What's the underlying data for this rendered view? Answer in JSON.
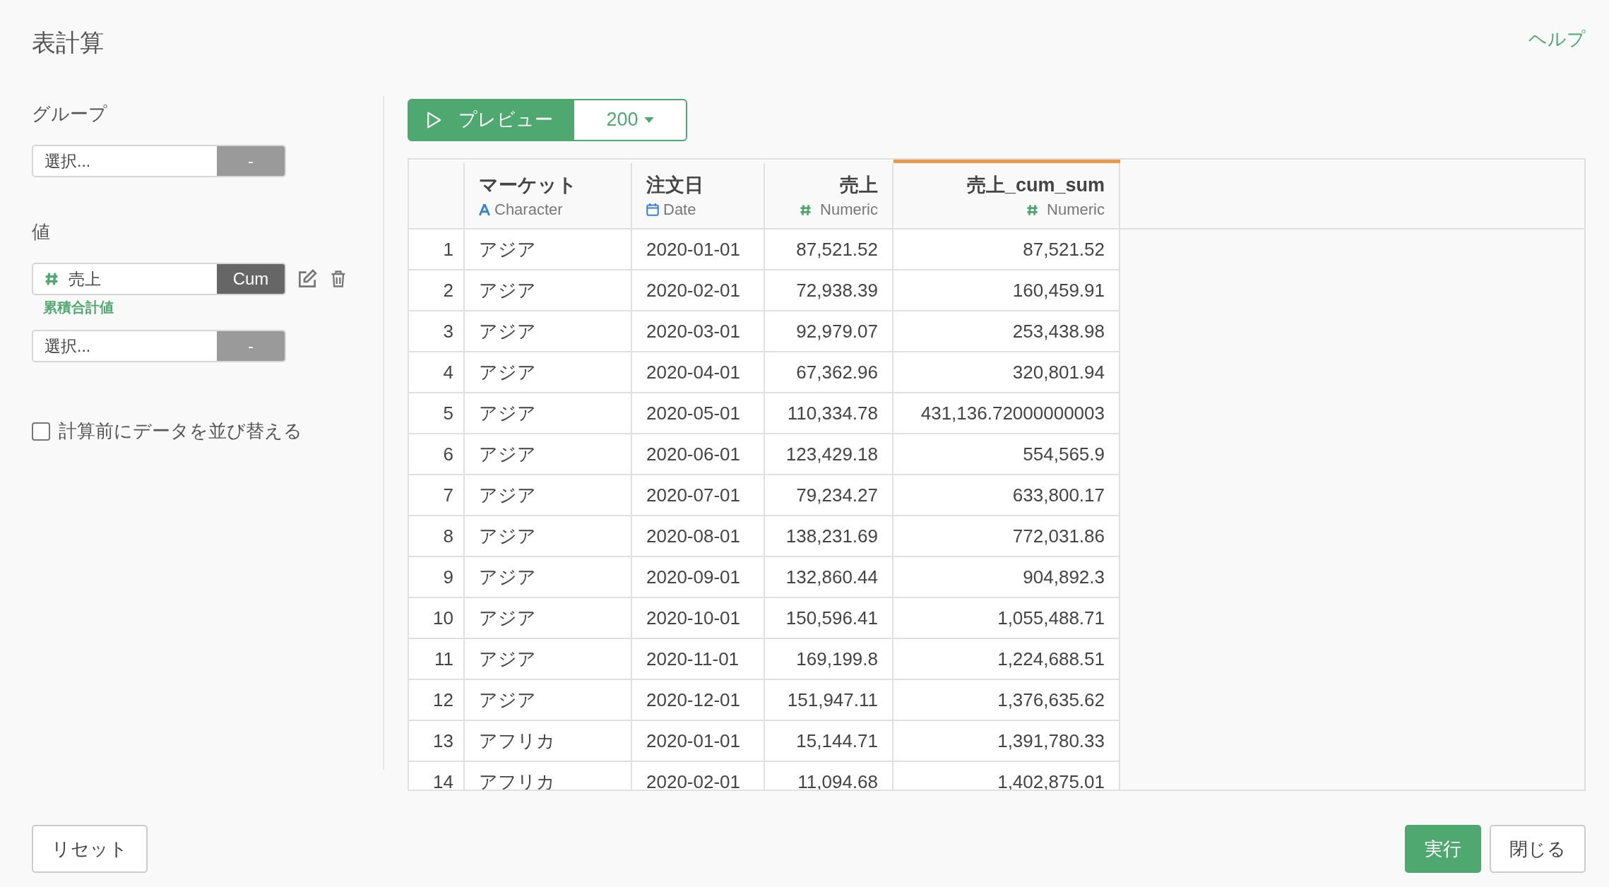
{
  "title": "表計算",
  "help_link": "ヘルプ",
  "group": {
    "label": "グループ",
    "select": {
      "placeholder": "選択...",
      "button": "-"
    }
  },
  "values": {
    "label": "値",
    "items": [
      {
        "kind": "numeric",
        "name": "売上",
        "function": "Cum",
        "caption": "累積合計値"
      }
    ],
    "new_select": {
      "placeholder": "選択...",
      "button": "-"
    }
  },
  "sort_checkbox": {
    "label": "計算前にデータを並び替える",
    "checked": false
  },
  "preview": {
    "label": "プレビュー",
    "count": "200"
  },
  "table": {
    "columns": [
      {
        "name": "マーケット",
        "type": "Character",
        "kind": "character",
        "highlighted": false
      },
      {
        "name": "注文日",
        "type": "Date",
        "kind": "date",
        "highlighted": false
      },
      {
        "name": "売上",
        "type": "Numeric",
        "kind": "numeric",
        "highlighted": false
      },
      {
        "name": "売上_cum_sum",
        "type": "Numeric",
        "kind": "numeric",
        "highlighted": true
      }
    ],
    "rows": [
      {
        "index": "1",
        "cells": [
          "アジア",
          "2020-01-01",
          "87,521.52",
          "87,521.52"
        ]
      },
      {
        "index": "2",
        "cells": [
          "アジア",
          "2020-02-01",
          "72,938.39",
          "160,459.91"
        ]
      },
      {
        "index": "3",
        "cells": [
          "アジア",
          "2020-03-01",
          "92,979.07",
          "253,438.98"
        ]
      },
      {
        "index": "4",
        "cells": [
          "アジア",
          "2020-04-01",
          "67,362.96",
          "320,801.94"
        ]
      },
      {
        "index": "5",
        "cells": [
          "アジア",
          "2020-05-01",
          "110,334.78",
          "431,136.72000000003"
        ]
      },
      {
        "index": "6",
        "cells": [
          "アジア",
          "2020-06-01",
          "123,429.18",
          "554,565.9"
        ]
      },
      {
        "index": "7",
        "cells": [
          "アジア",
          "2020-07-01",
          "79,234.27",
          "633,800.17"
        ]
      },
      {
        "index": "8",
        "cells": [
          "アジア",
          "2020-08-01",
          "138,231.69",
          "772,031.86"
        ]
      },
      {
        "index": "9",
        "cells": [
          "アジア",
          "2020-09-01",
          "132,860.44",
          "904,892.3"
        ]
      },
      {
        "index": "10",
        "cells": [
          "アジア",
          "2020-10-01",
          "150,596.41",
          "1,055,488.71"
        ]
      },
      {
        "index": "11",
        "cells": [
          "アジア",
          "2020-11-01",
          "169,199.8",
          "1,224,688.51"
        ]
      },
      {
        "index": "12",
        "cells": [
          "アジア",
          "2020-12-01",
          "151,947.11",
          "1,376,635.62"
        ]
      },
      {
        "index": "13",
        "cells": [
          "アフリカ",
          "2020-01-01",
          "15,144.71",
          "1,391,780.33"
        ]
      },
      {
        "index": "14",
        "cells": [
          "アフリカ",
          "2020-02-01",
          "11,094.68",
          "1,402,875.01"
        ]
      }
    ]
  },
  "footer": {
    "reset": "リセット",
    "run": "実行",
    "close": "閉じる"
  }
}
